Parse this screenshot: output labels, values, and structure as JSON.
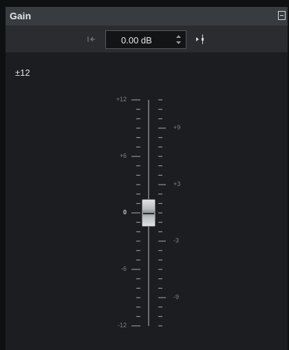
{
  "panel": {
    "title": "Gain",
    "collapse_icon": "collapse-icon"
  },
  "toolbar": {
    "reset_icon": "reset-to-default-icon",
    "value": "0.00 dB",
    "spinner_icon": "spinner-arrows-icon",
    "meter_icon": "meter-marker-icon"
  },
  "fader": {
    "range_label": "±12",
    "value_db": 0,
    "min_db": -12,
    "max_db": 12,
    "left_labels": [
      "+12",
      "+6",
      "0",
      "-6",
      "-12"
    ],
    "right_labels": [
      "+9",
      "+3",
      "-3",
      "-9"
    ]
  },
  "colors": {
    "panel_bg": "#1b1d20",
    "titlebar_bg": "#383b40",
    "toolbar_bg": "#2a2c30",
    "tick": "#a8abaf"
  }
}
